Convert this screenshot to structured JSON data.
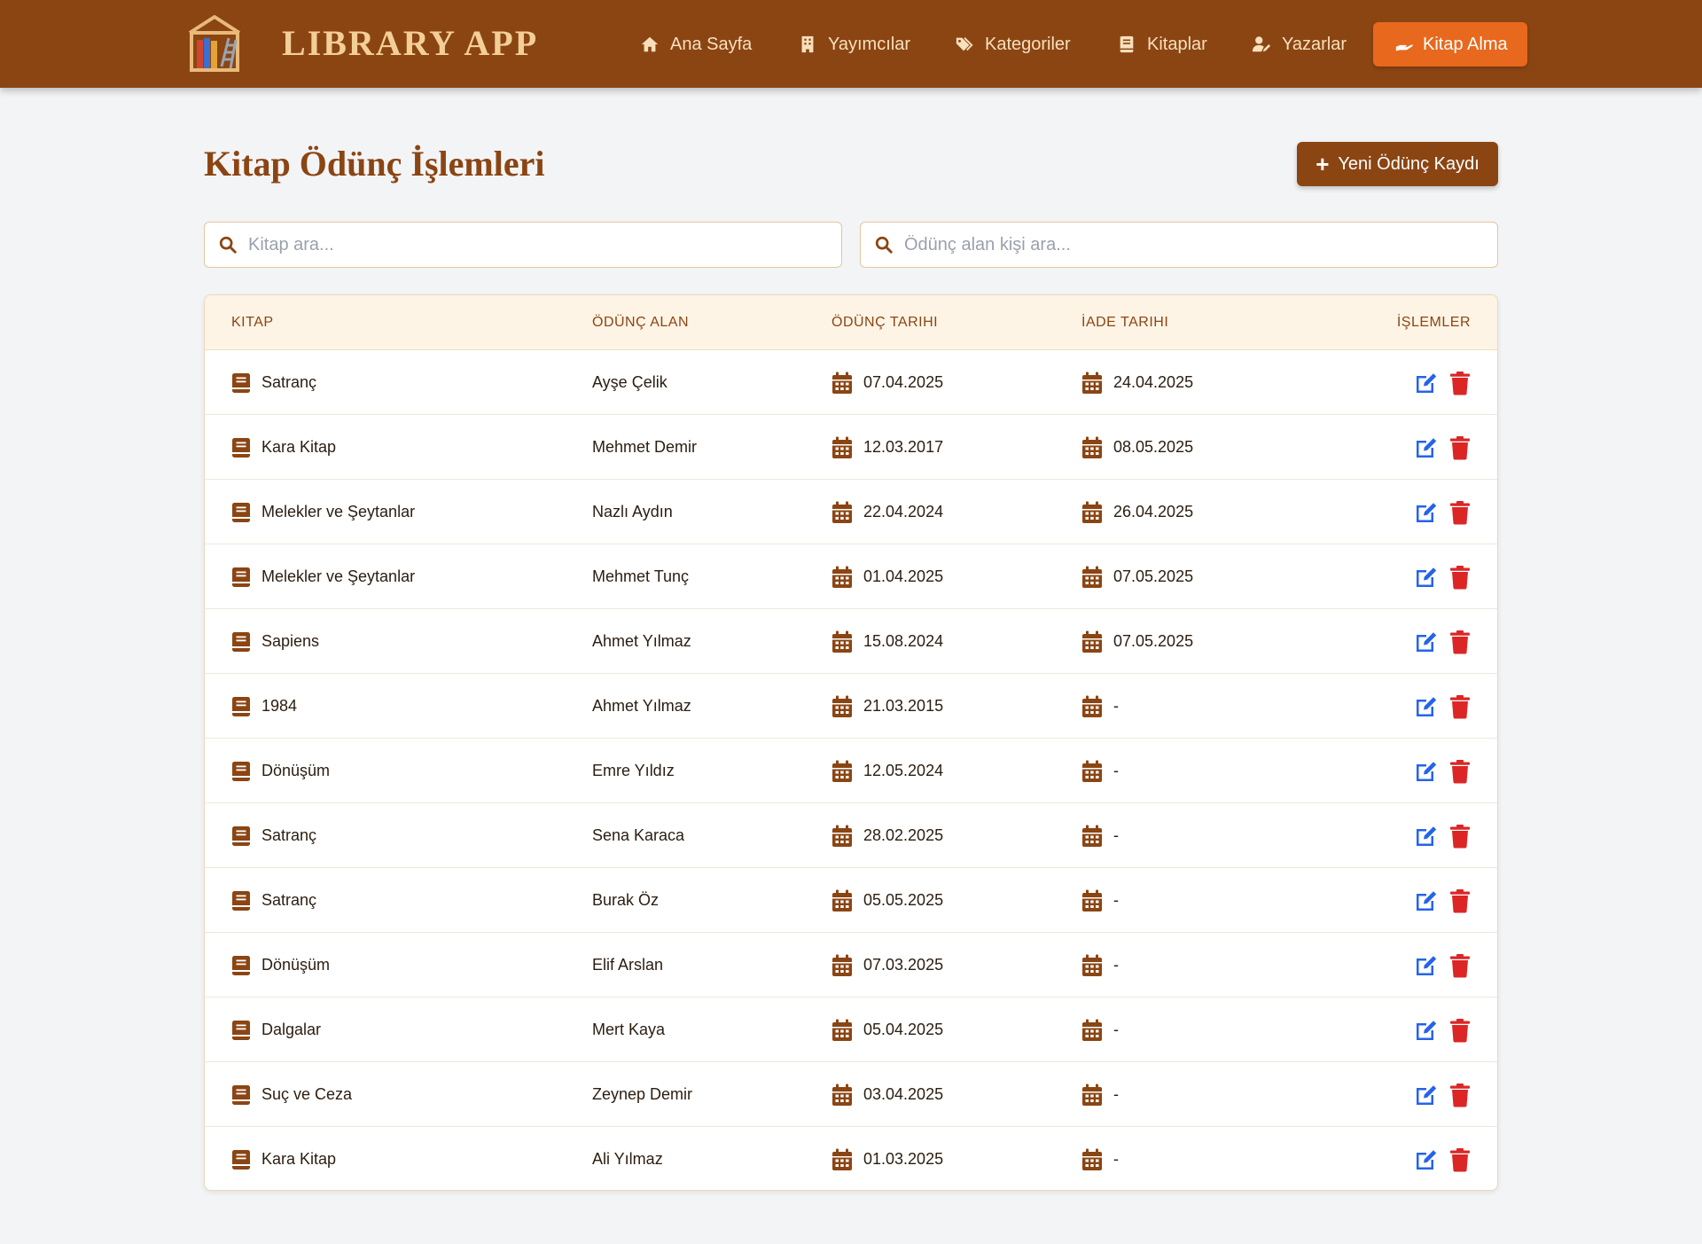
{
  "app": {
    "title": "LIBRARY APP",
    "logo_icon": "library-shelf-icon"
  },
  "colors": {
    "navbar": "#8b4513",
    "accent": "#e8681d",
    "primary": "#8b4513",
    "edit": "#2563eb",
    "delete": "#dc2626"
  },
  "nav": {
    "items": [
      {
        "label": "Ana Sayfa",
        "icon": "home-icon"
      },
      {
        "label": "Yayımcılar",
        "icon": "building-icon"
      },
      {
        "label": "Kategoriler",
        "icon": "tags-icon"
      },
      {
        "label": "Kitaplar",
        "icon": "book-icon"
      },
      {
        "label": "Yazarlar",
        "icon": "user-pen-icon"
      },
      {
        "label": "Kitap Alma",
        "icon": "hand-holding-icon",
        "active": true
      }
    ]
  },
  "main": {
    "title": "Kitap Ödünç İşlemleri",
    "new_button_label": "Yeni Ödünç Kaydı",
    "search_book_placeholder": "Kitap ara...",
    "search_person_placeholder": "Ödünç alan kişi ara..."
  },
  "table": {
    "headers": {
      "book": "KITAP",
      "borrower": "ÖDÜNÇ ALAN",
      "borrow_date": "ÖDÜNÇ TARIHI",
      "return_date": "İADE TARIHI",
      "actions": "İŞLEMLER"
    },
    "rows": [
      {
        "book": "Satranç",
        "borrower": "Ayşe Çelik",
        "borrow_date": "07.04.2025",
        "return_date": "24.04.2025"
      },
      {
        "book": "Kara Kitap",
        "borrower": "Mehmet Demir",
        "borrow_date": "12.03.2017",
        "return_date": "08.05.2025"
      },
      {
        "book": "Melekler ve Şeytanlar",
        "borrower": "Nazlı Aydın",
        "borrow_date": "22.04.2024",
        "return_date": "26.04.2025"
      },
      {
        "book": "Melekler ve Şeytanlar",
        "borrower": "Mehmet Tunç",
        "borrow_date": "01.04.2025",
        "return_date": "07.05.2025"
      },
      {
        "book": "Sapiens",
        "borrower": "Ahmet Yılmaz",
        "borrow_date": "15.08.2024",
        "return_date": "07.05.2025"
      },
      {
        "book": "1984",
        "borrower": "Ahmet Yılmaz",
        "borrow_date": "21.03.2015",
        "return_date": "-"
      },
      {
        "book": "Dönüşüm",
        "borrower": "Emre Yıldız",
        "borrow_date": "12.05.2024",
        "return_date": "-"
      },
      {
        "book": "Satranç",
        "borrower": "Sena Karaca",
        "borrow_date": "28.02.2025",
        "return_date": "-"
      },
      {
        "book": "Satranç",
        "borrower": "Burak Öz",
        "borrow_date": "05.05.2025",
        "return_date": "-"
      },
      {
        "book": "Dönüşüm",
        "borrower": "Elif Arslan",
        "borrow_date": "07.03.2025",
        "return_date": "-"
      },
      {
        "book": "Dalgalar",
        "borrower": "Mert Kaya",
        "borrow_date": "05.04.2025",
        "return_date": "-"
      },
      {
        "book": "Suç ve Ceza",
        "borrower": "Zeynep Demir",
        "borrow_date": "03.04.2025",
        "return_date": "-"
      },
      {
        "book": "Kara Kitap",
        "borrower": "Ali Yılmaz",
        "borrow_date": "01.03.2025",
        "return_date": "-"
      }
    ]
  }
}
